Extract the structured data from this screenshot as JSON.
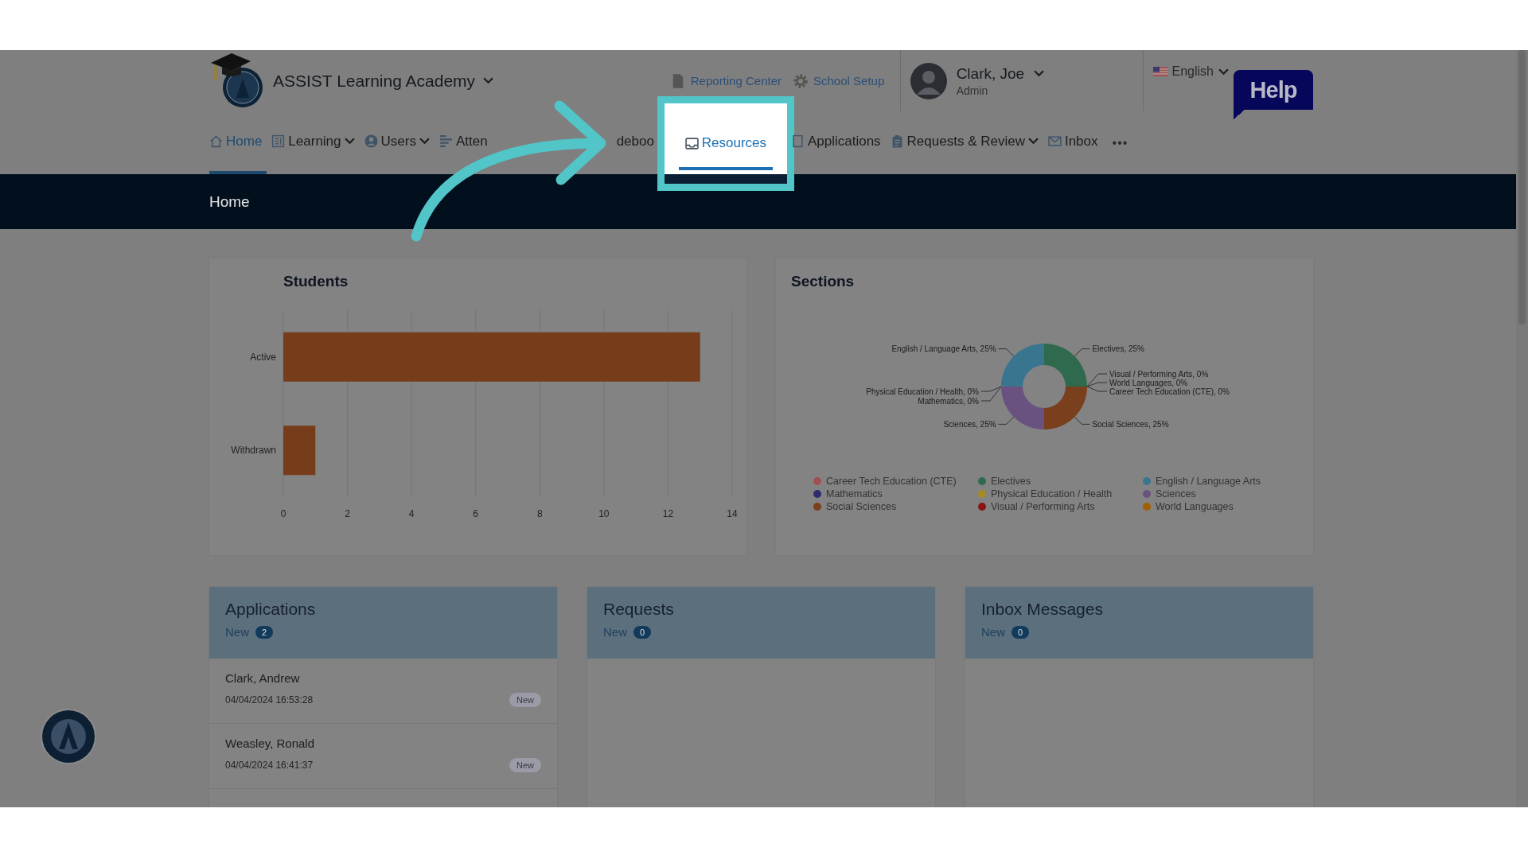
{
  "header": {
    "school": "ASSIST Learning Academy",
    "links": [
      {
        "label": "Reporting Center"
      },
      {
        "label": "School Setup"
      }
    ],
    "user": {
      "name": "Clark, Joe",
      "role": "Admin"
    },
    "language": "English",
    "help": "Help"
  },
  "nav": [
    {
      "kind": "tab",
      "label": "Home",
      "dropdown": false,
      "selected": true,
      "highlighted": false
    },
    {
      "kind": "tab",
      "label": "Learning",
      "dropdown": true,
      "selected": false,
      "highlighted": false
    },
    {
      "kind": "tab",
      "label": "Users",
      "dropdown": true,
      "selected": false,
      "highlighted": false
    },
    {
      "kind": "tab",
      "label": "Atten",
      "dropdown": false,
      "selected": false,
      "highlighted": false
    },
    {
      "kind": "tab",
      "label": "deboo",
      "dropdown": false,
      "selected": false,
      "highlighted": false
    },
    {
      "kind": "tab",
      "label": "Resources",
      "dropdown": false,
      "selected": true,
      "highlighted": true
    },
    {
      "kind": "tab",
      "label": "Applications",
      "dropdown": false,
      "selected": false,
      "highlighted": false
    },
    {
      "kind": "tab",
      "label": "Requests & Review",
      "dropdown": true,
      "selected": false,
      "highlighted": false
    },
    {
      "kind": "tab",
      "label": "Inbox",
      "dropdown": false,
      "selected": false,
      "highlighted": false
    },
    {
      "kind": "more",
      "label": "•••"
    }
  ],
  "page_title": "Home",
  "students": {
    "title": "Students",
    "chart_data": {
      "type": "bar",
      "orientation": "horizontal",
      "grid": true,
      "categories": [
        "Active",
        "Withdrawn"
      ],
      "values": [
        13,
        1
      ],
      "xlim": [
        0,
        14
      ],
      "xticks": [
        0,
        2,
        4,
        6,
        8,
        10,
        12,
        14
      ]
    }
  },
  "sections": {
    "title": "Sections",
    "chart_data": {
      "type": "donut",
      "legend": "bottom",
      "categories": [
        "Electives",
        "Visual / Performing Arts",
        "World Languages",
        "Career Tech Education (CTE)",
        "Social Sciences",
        "Sciences",
        "Physical Education / Health",
        "Mathematics",
        "English / Language Arts"
      ],
      "values": [
        25,
        0,
        0,
        0,
        25,
        25,
        0,
        0,
        25
      ],
      "colors": [
        "#2f6a4e",
        "#8a1515",
        "#a06000",
        "#a05050",
        "#7a3f1c",
        "#6a5280",
        "#a88a22",
        "#2c2c6e",
        "#3a7590"
      ],
      "value_labels": [
        "Electives, 25%",
        "Visual / Performing Arts, 0%",
        "World Languages, 0%",
        "Career Tech Education (CTE), 0%",
        "Social Sciences, 25%",
        "Sciences, 25%",
        "Physical Education / Health, 0%",
        "Mathematics, 0%",
        "English / Language Arts, 25%"
      ]
    }
  },
  "cards": [
    {
      "title": "Applications",
      "new_label": "New",
      "count": "2",
      "items": [
        {
          "name": "Clark, Andrew",
          "date": "04/04/2024 16:53:28",
          "status": "New"
        },
        {
          "name": "Weasley, Ronald",
          "date": "04/04/2024 16:41:37",
          "status": "New"
        }
      ]
    },
    {
      "title": "Requests",
      "new_label": "New",
      "count": "0"
    },
    {
      "title": "Inbox Messages",
      "new_label": "New",
      "count": "0"
    }
  ]
}
